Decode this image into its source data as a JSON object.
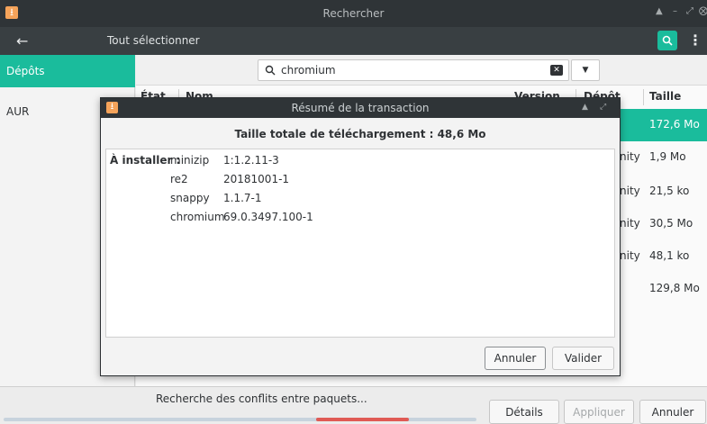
{
  "window": {
    "title": "Rechercher"
  },
  "header": {
    "select_all_label": "Tout sélectionner"
  },
  "sidebar": {
    "items": [
      {
        "label": "Dépôts"
      },
      {
        "label": "AUR"
      }
    ]
  },
  "search": {
    "value": "chromium"
  },
  "table": {
    "columns": [
      "État",
      "Nom",
      "Version",
      "Dépôt",
      "Taille"
    ],
    "rows": [
      {
        "repo": "",
        "size": "172,6 Mo",
        "selected": true
      },
      {
        "repo": "nity",
        "size": "1,9 Mo"
      },
      {
        "repo": "nity",
        "size": "21,5 ko"
      },
      {
        "repo": "nity",
        "size": "30,5 Mo"
      },
      {
        "repo": "nity",
        "size": "48,1 ko"
      },
      {
        "repo": "",
        "size": "129,8 Mo"
      }
    ]
  },
  "dialog": {
    "title": "Résumé de la transaction",
    "total": "Taille totale de téléchargement : 48,6 Mo",
    "install_label": "À installer :",
    "packages": [
      {
        "name": "minizip",
        "version": "1:1.2.11-3"
      },
      {
        "name": "re2",
        "version": "20181001-1"
      },
      {
        "name": "snappy",
        "version": "1.1.7-1"
      },
      {
        "name": "chromium",
        "version": "69.0.3497.100-1"
      }
    ],
    "cancel_label": "Annuler",
    "confirm_label": "Valider"
  },
  "footer": {
    "status": "Recherche des conflits entre paquets...",
    "details_label": "Détails",
    "apply_label": "Appliquer",
    "cancel_label": "Annuler"
  },
  "colors": {
    "accent": "#1abc9c",
    "progress": "#e05a55",
    "titlebar": "#2f3437"
  }
}
